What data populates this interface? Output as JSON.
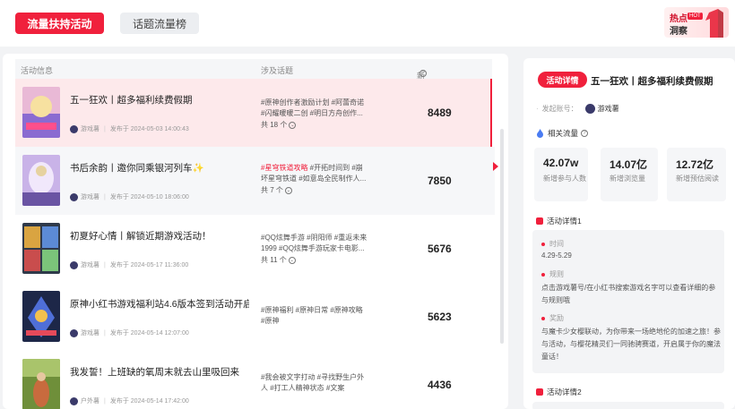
{
  "topbar": {
    "tab_active": "流量扶持活动",
    "tab_inactive": "话题流量榜",
    "hot_badge": {
      "line1": "热点",
      "tag": "HOT",
      "line2": "洞察"
    }
  },
  "table": {
    "headers": {
      "activity": "活动信息",
      "topics": "涉及话题",
      "new_posts": "新增爆文"
    },
    "rows": [
      {
        "title": "五一狂欢丨超多福利续费假期",
        "account": "游戏薯",
        "published_label": "发布于",
        "date": "2024-05-03 14:00:43",
        "topics_line1": "#原神创作者激励计划 #阿蕾奇诺",
        "topics_line2": "#闪耀暖暖二创 #明日方舟创作...",
        "topics_red": "",
        "topic_count": "共 18 个",
        "new_posts": "8489"
      },
      {
        "title": "书后余韵丨邀你同乘银河列车✨",
        "account": "游戏薯",
        "published_label": "发布于",
        "date": "2024-05-10 18:06:00",
        "topics_red": "#星穹铁道攻略",
        "topics_line1": " #开拓时间到 #崩",
        "topics_line2": "坏星穹铁道 #如意岛全民制作人...",
        "topic_count": "共 7 个",
        "new_posts": "7850"
      },
      {
        "title": "初夏好心情丨解锁近期游戏活动！",
        "account": "游戏薯",
        "published_label": "发布于",
        "date": "2024-05-17 11:36:00",
        "topics_red": "",
        "topics_line1": "#QQ炫舞手游 #阴阳师 #重返未来",
        "topics_line2": "1999 #QQ炫舞手游玩家卡电影...",
        "topic_count": "共 11 个",
        "new_posts": "5676"
      },
      {
        "title": "原神小红书游戏福利站4.6版本签到活动开启",
        "account": "游戏薯",
        "published_label": "发布于",
        "date": "2024-05-14 12:07:00",
        "topics_red": "",
        "topics_line1": "#原神福利 #原神日常 #原神攻略",
        "topics_line2": "#原神",
        "topic_count": "",
        "new_posts": "5623"
      },
      {
        "title": "我发誓！上班缺的氧周末就去山里吸回来",
        "account": "户外薯",
        "published_label": "发布于",
        "date": "2024-05-14 17:42:00",
        "topics_red": "",
        "topics_line1": "#我会被文字打动 #寻找野生户外",
        "topics_line2": "人 #打工人精神状态 #文案",
        "topic_count": "",
        "new_posts": "4436"
      }
    ]
  },
  "detail": {
    "pill": "活动详情",
    "title": "五一狂欢丨超多福利续费假期",
    "account_label": "发起账号：",
    "account_name": "游戏薯",
    "traffic_title": "相关流量",
    "stats": [
      {
        "value": "42.07w",
        "label": "新增参与人数"
      },
      {
        "value": "14.07亿",
        "label": "新增浏览量"
      },
      {
        "value": "12.72亿",
        "label": "新增预估阅读"
      }
    ],
    "section1": "活动详情1",
    "time_label": "时间",
    "time_value": "4.29-5.29",
    "rule_label": "规则",
    "rule_text": "点击游戏薯号/在小红书搜索游戏名字可以查看详细的参与规则哦",
    "reward_label": "奖励",
    "reward_text": "与魔卡少女樱联动，为你带来一场绝地伦的加速之旅！参与活动，与樱花精灵们一同驰骋赛道，开启属于你的魔法童话！",
    "section2": "活动详情2"
  },
  "colors": {
    "accent": "#f0203c"
  }
}
